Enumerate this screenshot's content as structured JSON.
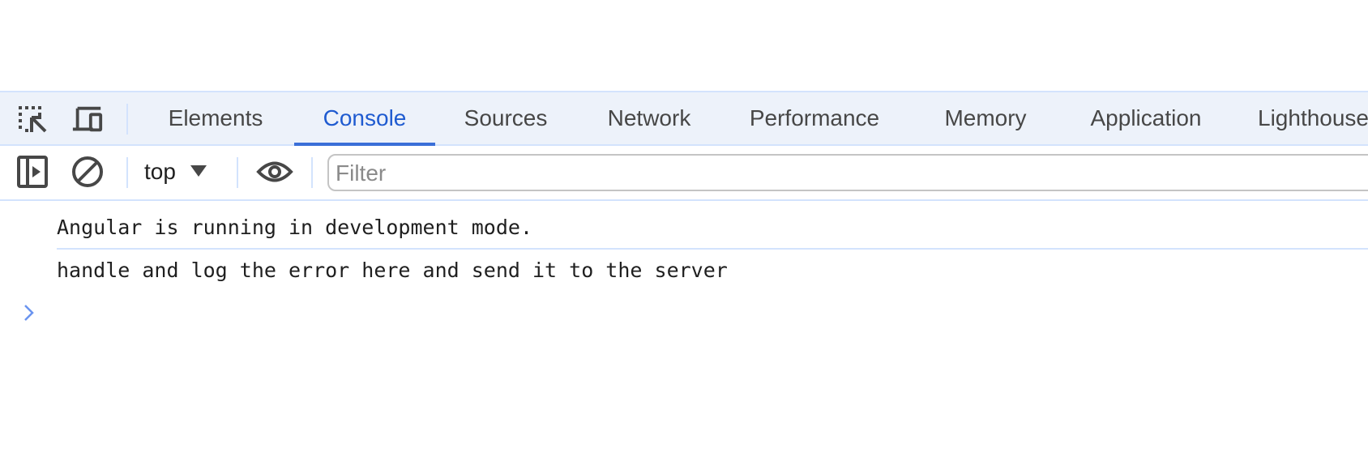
{
  "devtools": {
    "left_icons": [
      {
        "name": "inspect-element-icon",
        "title": "Select an element in the page to inspect it"
      },
      {
        "name": "device-toolbar-icon",
        "title": "Toggle device toolbar"
      }
    ],
    "tabs": [
      {
        "label": "Elements",
        "active": false
      },
      {
        "label": "Console",
        "active": true
      },
      {
        "label": "Sources",
        "active": false
      },
      {
        "label": "Network",
        "active": false
      },
      {
        "label": "Performance",
        "active": false
      },
      {
        "label": "Memory",
        "active": false
      },
      {
        "label": "Application",
        "active": false
      },
      {
        "label": "Lighthouse",
        "active": false
      }
    ],
    "accent_color": "#1f5bd0"
  },
  "console_toolbar": {
    "sidebar_icon": "show-console-sidebar-icon",
    "clear_icon": "clear-console-icon",
    "context_value": "top",
    "live_expression_icon": "eye-icon",
    "filter": {
      "placeholder": "Filter",
      "value": ""
    }
  },
  "console": {
    "messages": [
      {
        "text": "Angular is running in development mode."
      },
      {
        "text": "handle and log the error here and send it to the server"
      }
    ],
    "prompt_icon": "chevron-right-icon",
    "prompt_color": "#6a94f0"
  }
}
